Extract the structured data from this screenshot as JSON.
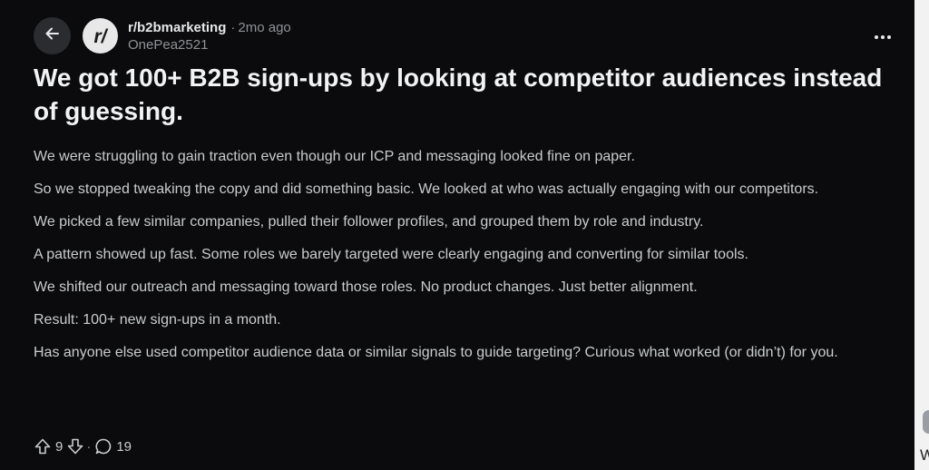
{
  "header": {
    "back_icon": "arrow-left-icon",
    "avatar_text": "r/",
    "subreddit": "r/b2bmarketing",
    "separator": "·",
    "age": "2mo ago",
    "author": "OnePea2521",
    "more_icon": "more-horizontal-icon"
  },
  "post": {
    "title": "We got 100+ B2B sign-ups by looking at competitor audiences instead of guessing.",
    "paragraphs": [
      "We were struggling to gain traction even though our ICP and messaging looked fine on paper.",
      "So we stopped tweaking the copy and did something basic. We looked at who was actually engaging with our competitors.",
      "We picked a few similar companies, pulled their follower profiles, and grouped them by role and industry.",
      "A pattern showed up fast. Some roles we barely targeted were clearly engaging and converting for similar tools.",
      "We shifted our outreach and messaging toward those roles. No product changes. Just better alignment.",
      "Result: 100+ new sign-ups in a month.",
      "Has anyone else used competitor audience data or similar signals to guide targeting? Curious what worked (or didn’t) for you."
    ]
  },
  "actions": {
    "upvote_icon": "upvote-arrow-icon",
    "vote_count": "9",
    "downvote_icon": "downvote-arrow-icon",
    "separator": "·",
    "comment_icon": "comment-bubble-icon",
    "comment_count": "19"
  },
  "side": {
    "letter": "W"
  },
  "colors": {
    "background": "#0b0b0d",
    "text": "#c9cccf",
    "title": "#f2f3f5",
    "muted": "#8e9296",
    "button_bg": "#2a2c2f"
  }
}
